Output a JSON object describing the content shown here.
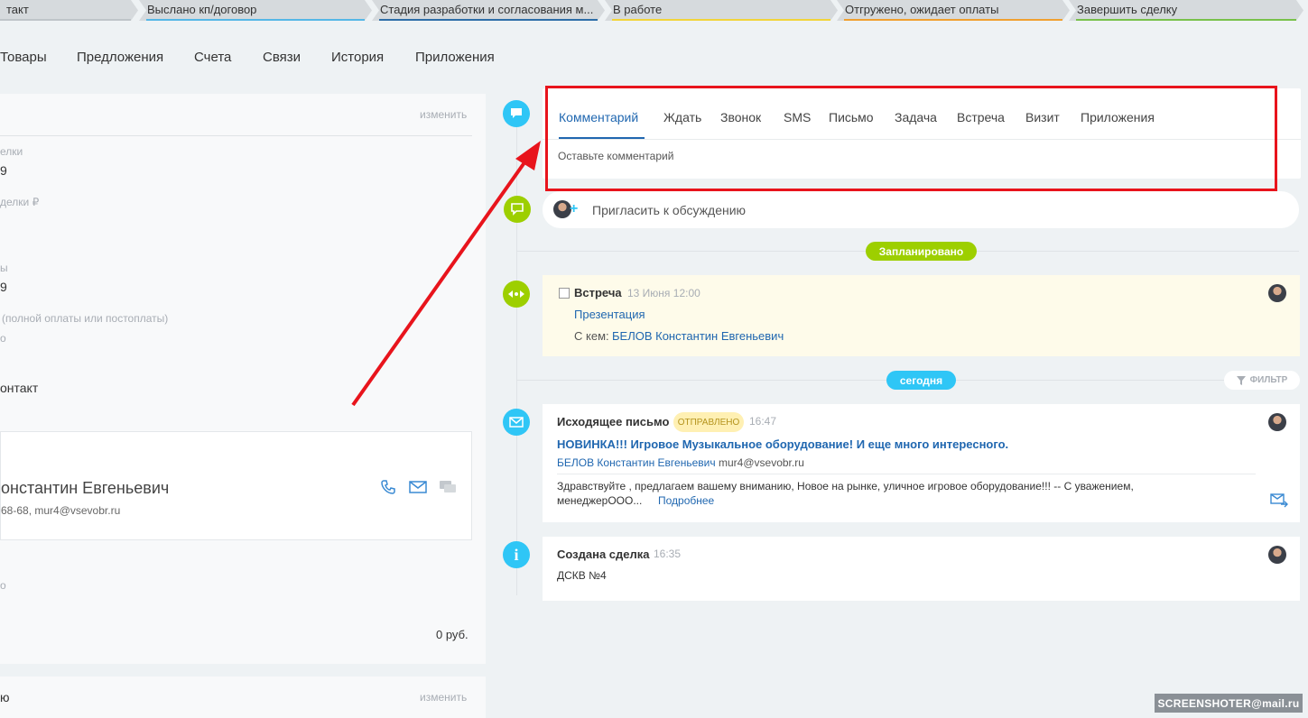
{
  "stages": [
    {
      "label": "такт",
      "color": "#bfc4c8"
    },
    {
      "label": "Выслано кп/договор",
      "color": "#55b7e6"
    },
    {
      "label": "Стадия разработки и согласования м...",
      "color": "#2d6ea8"
    },
    {
      "label": "В работе",
      "color": "#f2d43a"
    },
    {
      "label": "Отгружено, ожидает оплаты",
      "color": "#f0a030"
    },
    {
      "label": "Завершить сделку",
      "color": "#78c14a"
    }
  ],
  "tabs": [
    "Товары",
    "Предложения",
    "Счета",
    "Связи",
    "История",
    "Приложения"
  ],
  "left": {
    "edit1": "изменить",
    "f1_label": "елки",
    "f1_value": "9",
    "f2_label": "делки ₽",
    "f3_label": "ы",
    "f3_value": "9",
    "f4_label": "(полной оплаты или постоплаты)",
    "f4_value": "о",
    "contact_section": "онтакт",
    "contact_name": "онстантин Евгеньевич",
    "contact_details": "68-68, mur4@vsevobr.ru",
    "f5_label": "о",
    "sum": "0 руб.",
    "edit2": "изменить",
    "bottom_label": "ю"
  },
  "composer": {
    "tabs": [
      "Комментарий",
      "Ждать",
      "Звонок",
      "SMS",
      "Письмо",
      "Задача",
      "Встреча",
      "Визит",
      "Приложения"
    ],
    "placeholder": "Оставьте комментарий"
  },
  "invite": "Пригласить к обсуждению",
  "planned_badge": "Запланировано",
  "meeting": {
    "title": "Встреча",
    "time": "13 Июня 12:00",
    "subject": "Презентация",
    "with_label": "С кем:",
    "with_name": "БЕЛОВ Константин Евгеньевич"
  },
  "today_badge": "сегодня",
  "filter": "ФИЛЬТР",
  "email": {
    "title": "Исходящее письмо",
    "status": "ОТПРАВЛЕНО",
    "time": "16:47",
    "subject": "НОВИНКА!!! Игровое Музыкальное оборудование! И еще много интересного.",
    "from_name": "БЕЛОВ Константин Евгеньевич",
    "from_email": "mur4@vsevobr.ru",
    "body_line1": "Здравствуйте , предлагаем вашему вниманию, Новое на рынке,  уличное игровое оборудование!!! -- С уважением,",
    "body_line2": "менеджерООО...",
    "more": "Подробнее"
  },
  "deal": {
    "title": "Создана сделка",
    "time": "16:35",
    "name": "ДСКВ №4"
  },
  "watermark": "SCREENSHOTER@mail.ru",
  "colors": {
    "accent_blue": "#2fc6f6",
    "green": "#9dcf00",
    "annotation_red": "#e8141c"
  }
}
